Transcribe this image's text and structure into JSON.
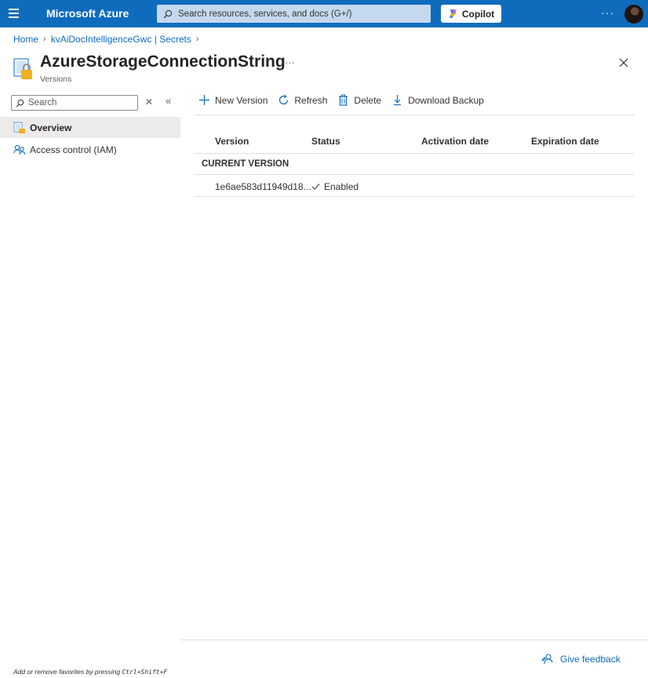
{
  "topbar": {
    "brand": "Microsoft Azure",
    "search_placeholder": "Search resources, services, and docs (G+/)",
    "copilot_label": "Copilot",
    "more_label": "···"
  },
  "breadcrumb": {
    "items": [
      "Home",
      "kvAiDocIntelligenceGwc | Secrets"
    ]
  },
  "header": {
    "title": "AzureStorageConnectionString",
    "subtitle": "Versions",
    "more_label": "···"
  },
  "sidebar": {
    "search_placeholder": "Search",
    "items": [
      {
        "label": "Overview",
        "icon": "key-vault-icon",
        "active": true
      },
      {
        "label": "Access control (IAM)",
        "icon": "people-icon",
        "active": false
      }
    ]
  },
  "toolbar": {
    "new_version": "New Version",
    "refresh": "Refresh",
    "delete": "Delete",
    "download_backup": "Download Backup"
  },
  "table": {
    "columns": [
      "Version",
      "Status",
      "Activation date",
      "Expiration date"
    ],
    "group_label": "CURRENT VERSION",
    "rows": [
      {
        "version": "1e6ae583d11949d18...",
        "status": "Enabled",
        "activation_date": "",
        "expiration_date": ""
      }
    ]
  },
  "footer": {
    "favorites_hint_prefix": "Add or remove favorites by pressing ",
    "favorites_hint_keys": "Ctrl+Shift+F",
    "feedback_label": "Give feedback"
  },
  "colors": {
    "brand_blue": "#0f6cbd",
    "active_nav_bg": "#edebe9",
    "key_gold": "#f2b01e"
  }
}
